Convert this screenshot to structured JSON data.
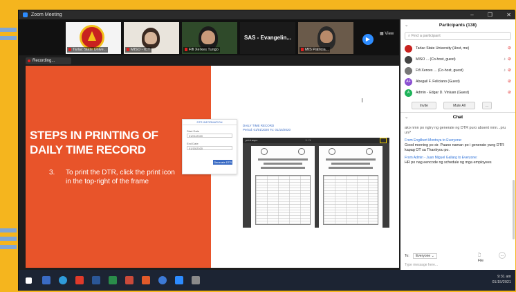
{
  "window": {
    "title": "Zoom Meeting",
    "controls": [
      "–",
      "❐",
      "✕"
    ]
  },
  "gallery": {
    "tiles": [
      {
        "name": "Tarlac State Unive..."
      },
      {
        "name": "MISO - ICT"
      },
      {
        "name": "Fifi Xerxes Tungo"
      },
      {
        "name": "SAS - Evangelin..."
      },
      {
        "name": "MIS Patricia..."
      }
    ],
    "view_label": "View"
  },
  "recording": {
    "label": "Recording..."
  },
  "slide": {
    "title_line1": "STEPS IN PRINTING OF",
    "title_line2": "DAILY TIME RECORD",
    "step_number": "3.",
    "step_text": "To print the DTR, click the print icon in the top-right of the frame",
    "dtr_title": "DAILY TIME RECORD",
    "dtr_period": "Period: 01/01/2020 To: 01/15/2020",
    "form_header": "DTR INFORMATION",
    "form_start_label": "Start Date",
    "form_start_value": "01/01/2020",
    "form_end_label": "End Date",
    "form_end_value": "01/15/2020",
    "form_button": "Generate DTR",
    "viewer_file": "print.aspx",
    "viewer_pages": "1 / 1"
  },
  "participants": {
    "header": "Participants (138)",
    "search_placeholder": "Find a participant",
    "list": [
      {
        "name": "Tarlac State University (Host, me)",
        "initials": "",
        "color": "#c8221f"
      },
      {
        "name": "MISO ... (Co-host, guest)",
        "initials": "",
        "color": "#444444"
      },
      {
        "name": "Fifi Xerxes ... (Co-host, guest)",
        "initials": "",
        "color": "#777777"
      },
      {
        "name": "Abegail F. Feliciano (Guest)",
        "initials": "AF",
        "color": "#8a4fd1"
      },
      {
        "name": "Admin - Edgar D. Vinluan (Guest)",
        "initials": "A",
        "color": "#1eb35a"
      }
    ],
    "invite_label": "Invite",
    "mute_all_label": "Mute All"
  },
  "chat": {
    "header": "Chat",
    "messages": [
      {
        "from": "",
        "text": "ako nmn po ngtry ng generate ng DTR puro absent nmn...pru un?"
      },
      {
        "from": "From Engilbert Montoya to Everyone:",
        "text": "Good morning po sir. Paano naman po i generate yung DTR kapag OT sa Thankyou po."
      },
      {
        "from": "From Admin - Juan Miguel Gallarg to Everyone:",
        "text": "HR po nag eencode ng schedule ng mga employees"
      }
    ],
    "to_label": "To:",
    "to_value": "Everyone",
    "file_label": "File",
    "type_placeholder": "Type message here..."
  },
  "taskbar": {
    "time": "9:31 am",
    "date": "01/15/2021"
  }
}
